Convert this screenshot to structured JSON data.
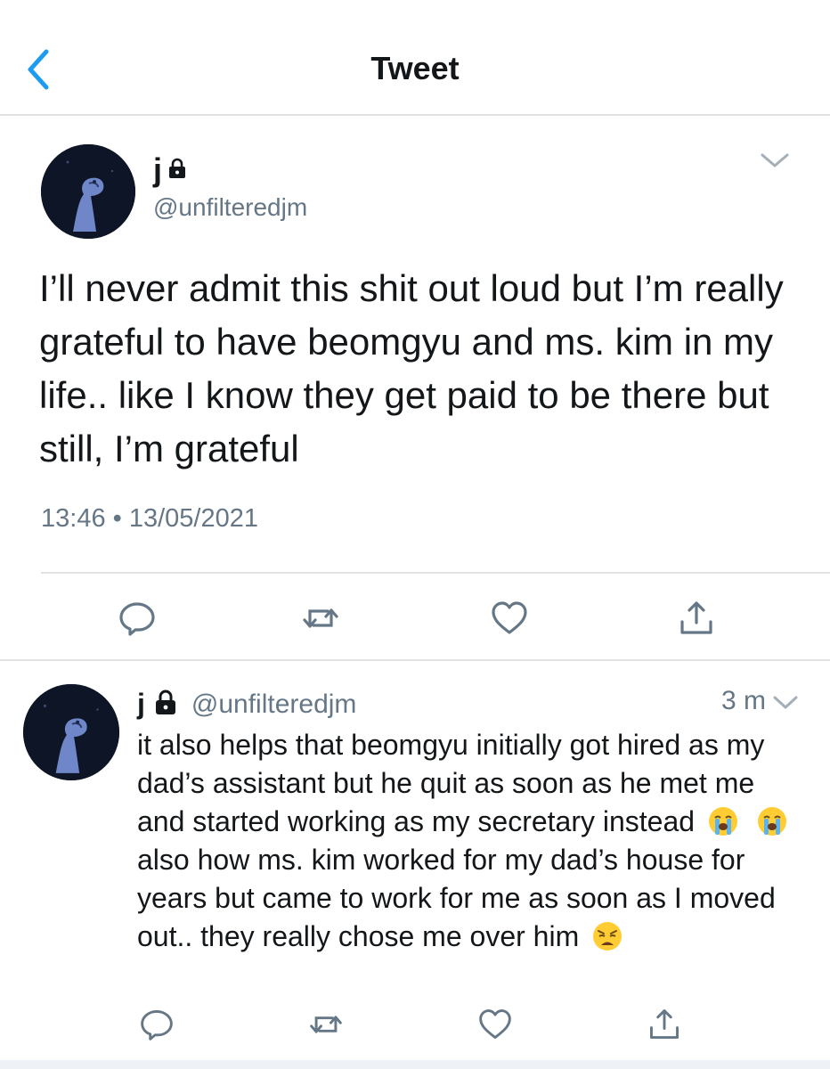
{
  "header": {
    "title": "Tweet",
    "back_icon": "chevron-left-icon",
    "accent": "#1d9bf0"
  },
  "tweet": {
    "name": "j",
    "handle": "@unfilteredjm",
    "text": "I’ll never admit this shit out loud but I’m really grateful to have beomgyu and ms. kim in my life.. like I know they get paid to be there but still, I’m grateful",
    "timestamp": "13:46 • 13/05/2021",
    "icons": [
      "reply-icon",
      "retweet-icon",
      "like-icon",
      "share-icon"
    ]
  },
  "reply": {
    "name": "j",
    "handle": "@unfilteredjm",
    "time": "3 m",
    "text_part1": "it also helps that beomgyu initially got hired as my dad’s assistant but he quit as soon as he met me and started working as my secretary instead",
    "text_part2": "also how ms. kim worked for my dad’s house for years but came to work for me as soon as I moved out.. they really chose me over him",
    "emojis": [
      "loudly-crying-face-emoji",
      "loudly-crying-face-emoji",
      "weary-face-emoji"
    ]
  }
}
